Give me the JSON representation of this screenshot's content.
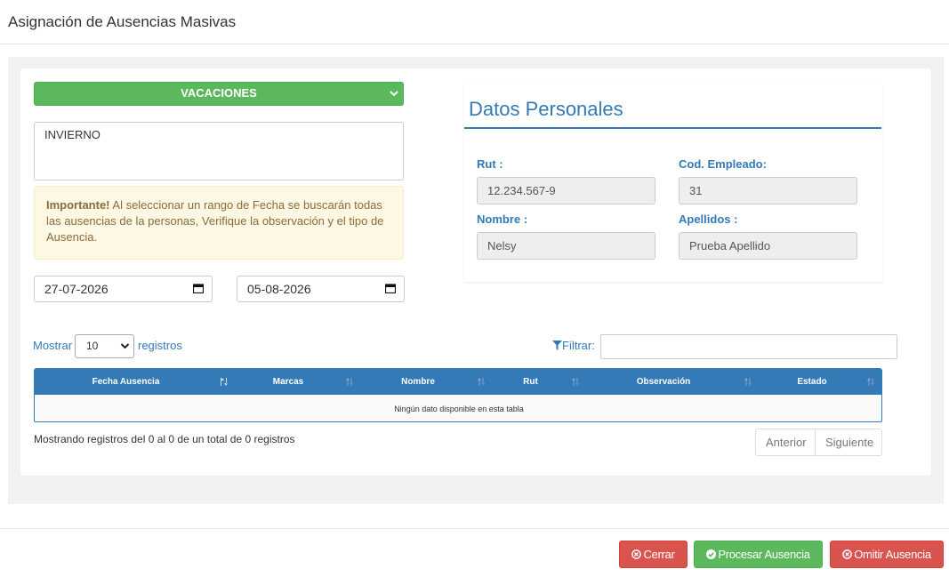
{
  "modal": {
    "title": "Asignación de Ausencias Masivas"
  },
  "form": {
    "absence_type": "VACACIONES",
    "observation": "INVIERNO",
    "alert_strong": "Importante!",
    "alert_text": " Al seleccionar un rango de Fecha se buscarán todas las ausencias de la personas, Verifique la observación y el tipo de Ausencia.",
    "date_from": "27-07-2026",
    "date_to": "05-08-2026"
  },
  "personal": {
    "title": "Datos Personales",
    "rut_label": "Rut :",
    "rut_value": "12.234.567-9",
    "code_label": "Cod. Empleado:",
    "code_value": "31",
    "name_label": "Nombre :",
    "name_value": "Nelsy",
    "lastname_label": "Apellidos :",
    "lastname_value": "Prueba Apellido"
  },
  "table": {
    "show_label": "Mostrar",
    "page_size": "10",
    "records_label": "registros",
    "filter_label": "Filtrar:",
    "filter_value": "",
    "columns": [
      "Fecha Ausencia",
      "Marcas",
      "Nombre",
      "Rut",
      "Observación",
      "Estado"
    ],
    "empty_text": "Ningún dato disponible en esta tabla",
    "info": "Mostrando registros del 0 al 0 de un total de 0 registros",
    "prev_label": "Anterior",
    "next_label": "Siguiente"
  },
  "footer": {
    "close_label": "Cerrar",
    "process_label": "Procesar Ausencia",
    "skip_label": "Omitir Ausencia"
  },
  "colors": {
    "primary": "#337ab7",
    "success": "#5cb85c",
    "danger": "#d9534f",
    "warning_bg": "#fcf8e3",
    "warning_text": "#8a6d3b"
  }
}
